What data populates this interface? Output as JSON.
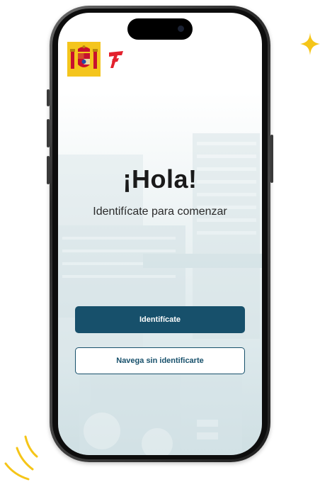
{
  "greeting": {
    "title": "¡Hola!",
    "subtitle": "Identifícate para comenzar"
  },
  "actions": {
    "login_label": "Identifícate",
    "guest_label": "Navega sin identificarte"
  },
  "logos": {
    "gov": "spain-coat-of-arms-icon",
    "transport": "transport-ministry-icon"
  },
  "colors": {
    "primary": "#17506b",
    "on_primary": "#ffffff",
    "accent_yellow": "#f5c518",
    "logo_red": "#e3212d"
  }
}
